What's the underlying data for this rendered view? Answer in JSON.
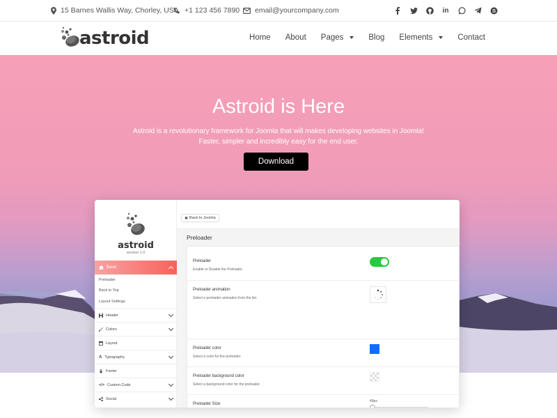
{
  "topbar": {
    "address": "15 Barnes Wallis Way, Chorley, USA",
    "phone": "+1 123 456 7890",
    "email": "email@yourcompany.com",
    "social_icons": [
      "facebook-icon",
      "twitter-icon",
      "github-icon",
      "linkedin-icon",
      "whatsapp-icon",
      "telegram-icon",
      "skype-icon"
    ]
  },
  "header": {
    "logo_text": "astroid",
    "nav": [
      {
        "label": "Home",
        "dropdown": false
      },
      {
        "label": "About",
        "dropdown": false
      },
      {
        "label": "Pages",
        "dropdown": true
      },
      {
        "label": "Blog",
        "dropdown": false
      },
      {
        "label": "Elements",
        "dropdown": true
      },
      {
        "label": "Contact",
        "dropdown": false
      }
    ]
  },
  "hero": {
    "title": "Astroid is Here",
    "subtitle": "Astroid is a revolutionary framework for Joomla that will makes developing websites in Joomla! Faster, simpler and incredibly easy for the end user.",
    "button": "Download"
  },
  "admin": {
    "logo_name": "astroid",
    "version": "version 1.0",
    "active_item": "Basic",
    "sub_items": [
      "Preloader",
      "Back to Top",
      "Layout Settings"
    ],
    "menu": [
      "Header",
      "Colors",
      "Layout",
      "Typography",
      "Footer",
      "Custom Code",
      "Social"
    ],
    "back_button": "Back to Joomla",
    "section_title": "Preloader",
    "options": [
      {
        "label": "Preloader",
        "desc": "Enable or Disable the Preloader."
      },
      {
        "label": "Preloader animation",
        "desc": "Select a preloader animation from the list."
      },
      {
        "label": "Preloader color",
        "desc": "Select a color for the preloader."
      },
      {
        "label": "Preloader background color",
        "desc": "Select a background color for the preloader."
      },
      {
        "label": "Preloader Size",
        "desc": ""
      }
    ],
    "preloader_enabled": true,
    "preloader_color": "#0d6efd",
    "size_value": "40px",
    "size_fraction": 0.0
  },
  "colors": {
    "accent": "#f9625b",
    "toggle_on": "#28c940",
    "button_bg": "#000000"
  }
}
